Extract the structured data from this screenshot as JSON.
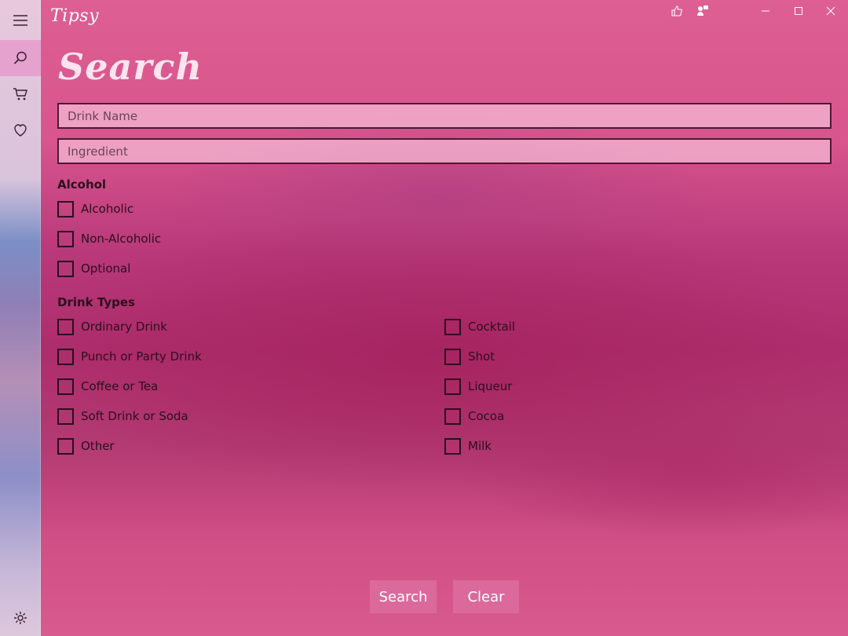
{
  "app": {
    "logo_text": "Tipsy"
  },
  "nav": {
    "items": [
      {
        "icon": "hamburger-icon",
        "active": false
      },
      {
        "icon": "search-icon",
        "active": true
      },
      {
        "icon": "cart-icon",
        "active": false
      },
      {
        "icon": "heart-icon",
        "active": false
      },
      {
        "icon": "gear-icon",
        "active": false
      }
    ]
  },
  "titlebar": {
    "icons": [
      "thumbs-up-icon",
      "feedback-icon",
      "minimize-icon",
      "maximize-icon",
      "close-icon"
    ]
  },
  "search": {
    "title": "Search",
    "drink_name_placeholder": "Drink Name",
    "drink_name_value": "",
    "ingredient_placeholder": "Ingredient",
    "ingredient_value": ""
  },
  "alcohol": {
    "label": "Alcohol",
    "options": [
      {
        "label": "Alcoholic",
        "checked": false
      },
      {
        "label": "Non-Alcoholic",
        "checked": false
      },
      {
        "label": "Optional",
        "checked": false
      }
    ]
  },
  "drink_types": {
    "label": "Drink Types",
    "left": [
      {
        "label": "Ordinary Drink",
        "checked": false
      },
      {
        "label": "Punch or Party Drink",
        "checked": false
      },
      {
        "label": "Coffee or Tea",
        "checked": false
      },
      {
        "label": "Soft Drink or Soda",
        "checked": false
      },
      {
        "label": "Other",
        "checked": false
      }
    ],
    "right": [
      {
        "label": "Cocktail",
        "checked": false
      },
      {
        "label": "Shot",
        "checked": false
      },
      {
        "label": "Liqueur",
        "checked": false
      },
      {
        "label": "Cocoa",
        "checked": false
      },
      {
        "label": "Milk",
        "checked": false
      }
    ]
  },
  "actions": {
    "search_label": "Search",
    "clear_label": "Clear"
  },
  "colors": {
    "accent": "#d8558d",
    "text": "#2b0f1d",
    "field_border": "#4a1a34"
  }
}
